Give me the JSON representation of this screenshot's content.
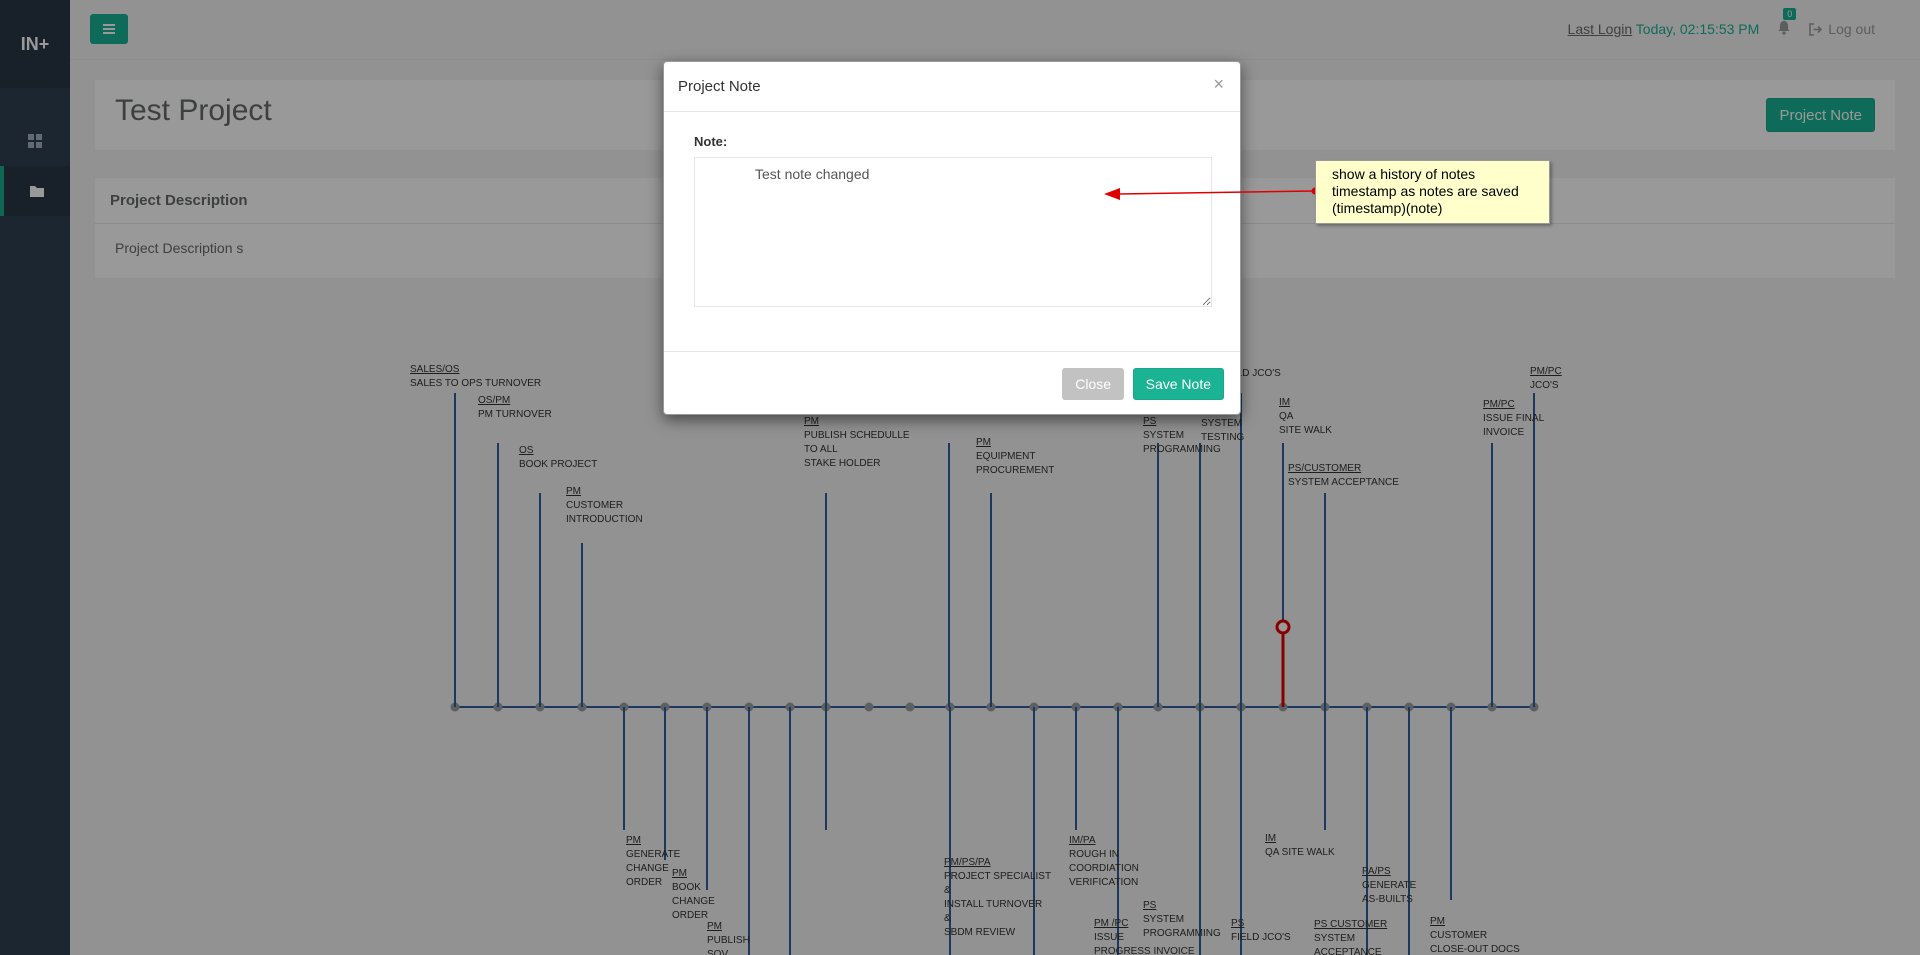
{
  "sidebar": {
    "logo": "IN+",
    "items": [
      {
        "icon": "dashboard-icon"
      },
      {
        "icon": "folder-icon"
      }
    ]
  },
  "topbar": {
    "last_login_label": "Last Login",
    "last_login_value": "Today, 02:15:53 PM",
    "notification_count": "0",
    "logout_label": "Log out"
  },
  "page": {
    "title": "Test Project",
    "project_note_button": "Project Note",
    "description_header": "Project Description",
    "description_text": "Project Description s"
  },
  "timeline": {
    "upper_labels": [
      {
        "role": "SALES/OS",
        "text": [
          "SALES TO OPS TURNOVER"
        ]
      },
      {
        "role": "OS/PM",
        "text": [
          "PM TURNOVER"
        ]
      },
      {
        "role": "OS",
        "text": [
          "BOOK PROJECT"
        ]
      },
      {
        "role": "PM",
        "text": [
          "CUSTOMER",
          "INTRODUCTION"
        ]
      },
      {
        "role": "PM",
        "text": [
          "PUBLISH SCHEDULLE",
          "TO ALL",
          "STAKE HOLDER"
        ]
      },
      {
        "role": "PM",
        "text": [
          "EQUIPMENT",
          "PROCUREMENT"
        ]
      },
      {
        "role": "PS",
        "text": [
          "SYSTEM",
          "PROGRAMMING"
        ]
      },
      {
        "role": "",
        "text": [
          "SYSTEM",
          "TESTING"
        ]
      },
      {
        "role": "",
        "text": [
          "ELD JCO'S"
        ]
      },
      {
        "role": "IM",
        "text": [
          "QA",
          "SITE WALK"
        ]
      },
      {
        "role": "PS/CUSTOMER",
        "text": [
          "SYSTEM ACCEPTANCE"
        ]
      },
      {
        "role": "PM/PC",
        "text": [
          "ISSUE FINAL",
          "INVOICE"
        ]
      },
      {
        "role": "PM/PC",
        "text": [
          "JCO'S"
        ]
      }
    ],
    "lower_labels": [
      {
        "role": "PM",
        "text": [
          "GENERATE",
          "CHANGE",
          "ORDER"
        ]
      },
      {
        "role": "PM",
        "text": [
          "BOOK",
          "CHANGE",
          "ORDER"
        ]
      },
      {
        "role": "PM",
        "text": [
          "PUBLISH",
          "SOV"
        ]
      },
      {
        "role": "PM/PS/PA",
        "text": [
          "PROJECT SPECIALIST",
          "&",
          "INSTALL TURNOVER",
          "&",
          "SBDM REVIEW"
        ]
      },
      {
        "role": "IM/PA",
        "text": [
          "ROUGH IN",
          "COORDIATION",
          "VERIFICATION"
        ]
      },
      {
        "role": "PM /PC",
        "text": [
          "ISSUE",
          "PROGRESS INVOICE"
        ]
      },
      {
        "role": "PS",
        "text": [
          "SYSTEM",
          "PROGRAMMING"
        ]
      },
      {
        "role": "PS",
        "text": [
          "FIELD JCO'S"
        ]
      },
      {
        "role": "IM",
        "text": [
          "QA SITE WALK"
        ]
      },
      {
        "role": "PS CUSTOMER",
        "text": [
          "SYSTEM",
          "ACCEPTANCE"
        ]
      },
      {
        "role": "PA/PS",
        "text": [
          "GENERATE",
          "AS-BUILTS"
        ]
      },
      {
        "role": "PM",
        "text": [
          "CUSTOMER",
          "CLOSE-OUT DOCS"
        ]
      }
    ]
  },
  "modal": {
    "title": "Project Note",
    "close_symbol": "×",
    "note_label": "Note:",
    "note_value": "Test note changed",
    "close_button": "Close",
    "save_button": "Save Note"
  },
  "annotation": {
    "lines": [
      "show a history of notes",
      "timestamp as notes are saved",
      "(timestamp)(note)"
    ]
  },
  "colors": {
    "accent": "#1ab394",
    "sidebar": "#2f4050",
    "timeline_line": "#2e5f9e",
    "annotation_arrow": "#e00000",
    "annotation_bg": "#ffffcc"
  }
}
